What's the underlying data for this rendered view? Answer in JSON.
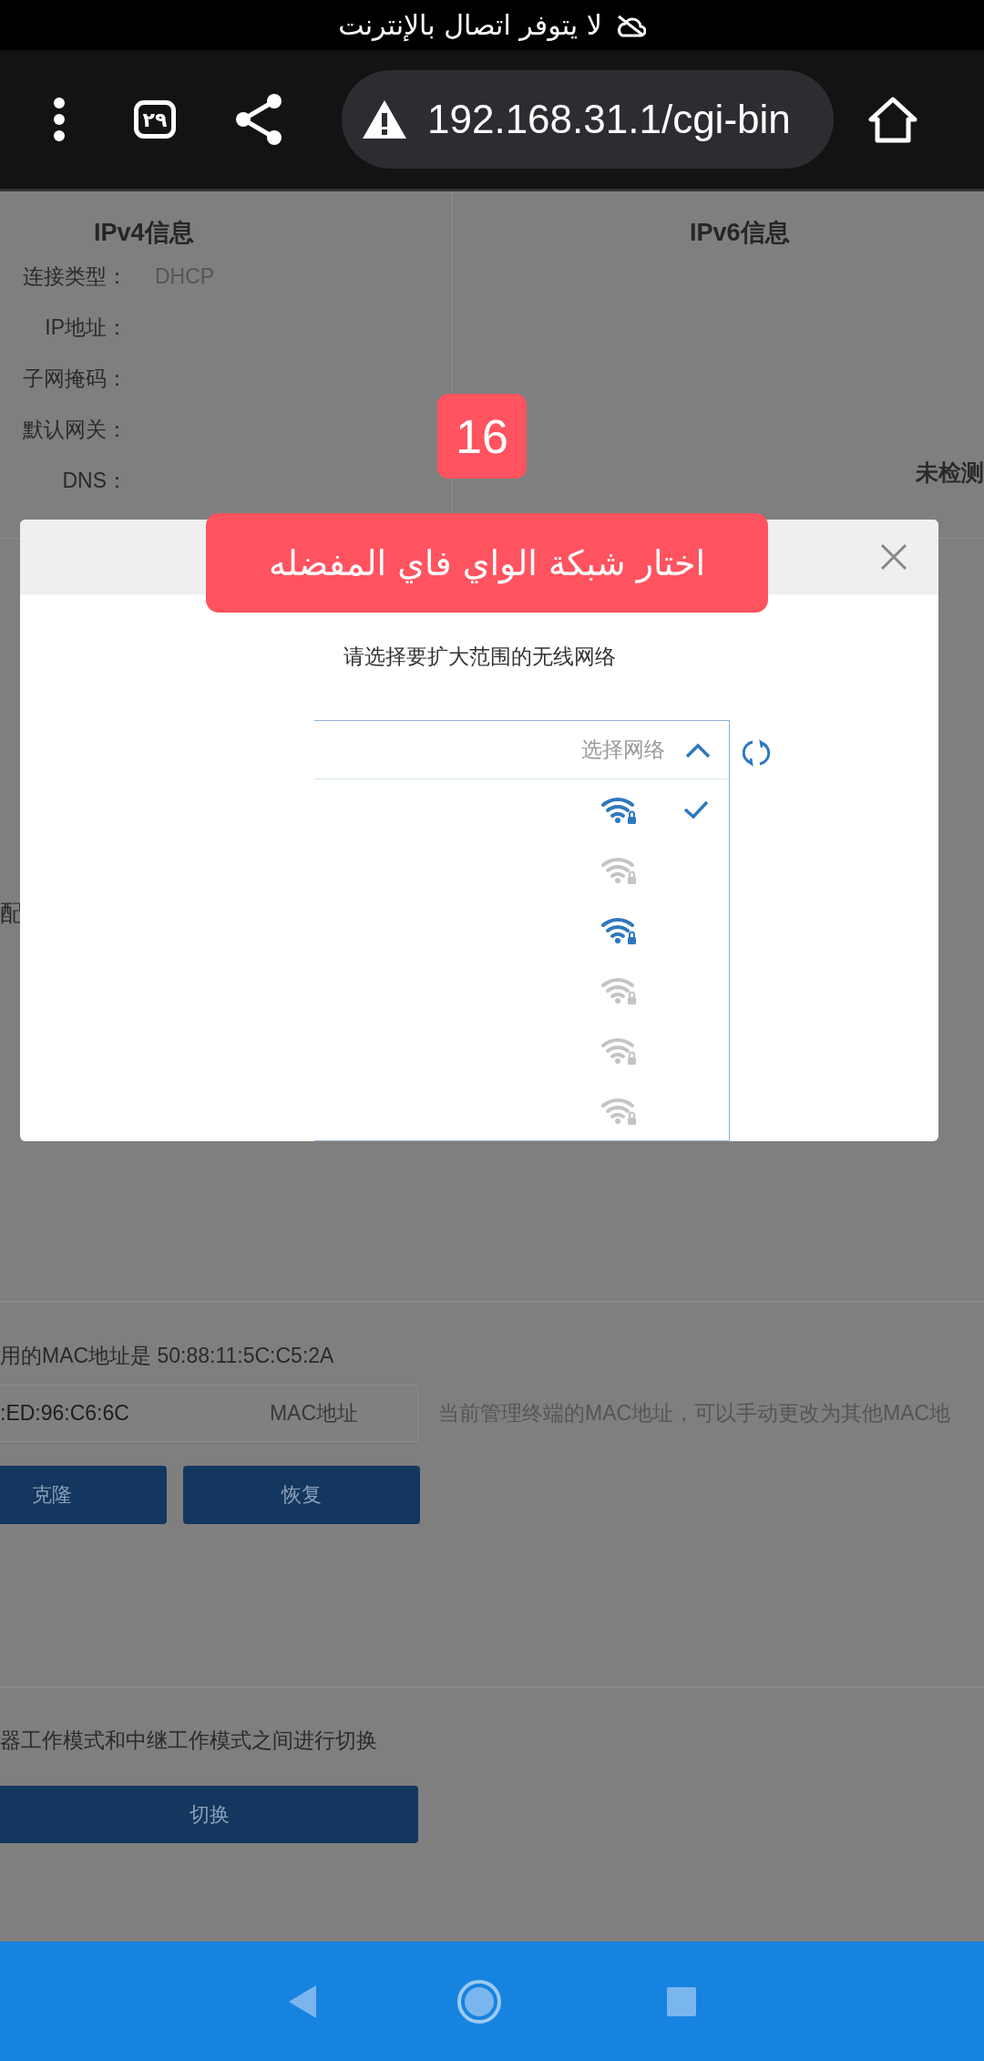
{
  "status_bar": {
    "message": "لا يتوفر اتصال بالإنترنت"
  },
  "browser": {
    "tab_count": "٢٩",
    "url": "192.168.31.1/cgi-bin"
  },
  "page": {
    "ipv4": {
      "title": "IPv4信息",
      "rows": [
        {
          "label": "连接类型：",
          "value": "DHCP"
        },
        {
          "label": "IP地址："
        },
        {
          "label": "子网掩码："
        },
        {
          "label": "默认网关："
        },
        {
          "label": "DNS："
        }
      ]
    },
    "ipv6": {
      "title": "IPv6信息",
      "status": "未检测"
    },
    "side_fragment": "配",
    "mac": {
      "current": "用的MAC地址是 50:88:11:5C:C5:2A",
      "value": ":ED:96:C6:6C",
      "field_label": "MAC地址",
      "hint": "当前管理终端的MAC地址，可以手动更改为其他MAC地",
      "buttons": [
        "克隆",
        "恢复"
      ]
    },
    "mode": {
      "text": "器工作模式和中继工作模式之间进行切换",
      "button": "切换"
    }
  },
  "step_badge": "16",
  "modal": {
    "banner": "اختار شبكة الواي فاي المفضله",
    "prompt": "请选择要扩大范围的无线网络",
    "dropdown": {
      "placeholder": "选择网络",
      "expanded": true,
      "networks": [
        {
          "selected": true,
          "strong": true
        },
        {
          "selected": false,
          "strong": false
        },
        {
          "selected": false,
          "strong": true
        },
        {
          "selected": false,
          "strong": false
        },
        {
          "selected": false,
          "strong": false
        },
        {
          "selected": false,
          "strong": false
        }
      ]
    }
  }
}
